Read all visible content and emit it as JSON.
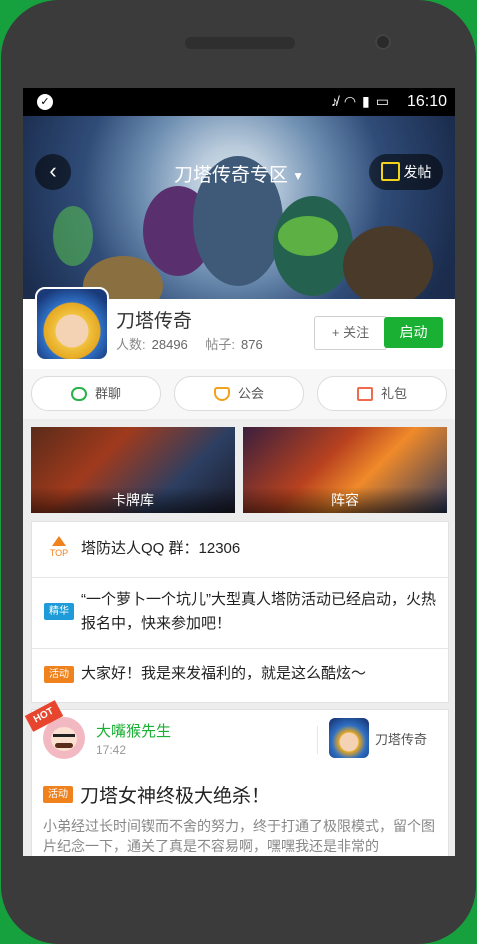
{
  "status_bar": {
    "time": "16:10",
    "icons": [
      "notification-icon",
      "mute-icon",
      "wifi-icon",
      "signal-icon",
      "battery-icon"
    ]
  },
  "header": {
    "title": "刀塔传奇专区",
    "post_label": "发帖"
  },
  "game": {
    "name": "刀塔传奇",
    "members_label": "人数:",
    "members": "28496",
    "posts_label": "帖子:",
    "posts": "876",
    "follow_label": "+ 关注",
    "launch_label": "启动"
  },
  "tabs": [
    {
      "label": "群聊",
      "icon": "chat-icon"
    },
    {
      "label": "公会",
      "icon": "guild-icon"
    },
    {
      "label": "礼包",
      "icon": "gift-icon"
    }
  ],
  "cards": [
    {
      "label": "卡牌库"
    },
    {
      "label": "阵容"
    }
  ],
  "notices": [
    {
      "tag": "TOP",
      "text": "塔防达人QQ 群：12306"
    },
    {
      "tag": "精华",
      "text": "“一个萝卜一个坑儿”大型真人塔防活动已经启动，火热报名中，快来参加吧！"
    },
    {
      "tag": "活动",
      "text": "大家好！我是来发福利的，就是这么酷炫～"
    }
  ],
  "post": {
    "badge": "HOT",
    "author": "大嘴猴先生",
    "time": "17:42",
    "game_name": "刀塔传奇",
    "tag": "活动",
    "title": "刀塔女神终极大绝杀！",
    "body": "小弟经过长时间锲而不舍的努力，终于打通了极限模式，留个图片纪念一下，通关了真是不容易啊，嘿嘿我还是非常的"
  },
  "colors": {
    "accent_green": "#1ab033",
    "phone_body": "#3b3b3b",
    "background_green": "#16a13e",
    "tag_orange": "#f0821e",
    "tag_blue": "#1e9bd8",
    "hot_red": "#e8452e"
  }
}
